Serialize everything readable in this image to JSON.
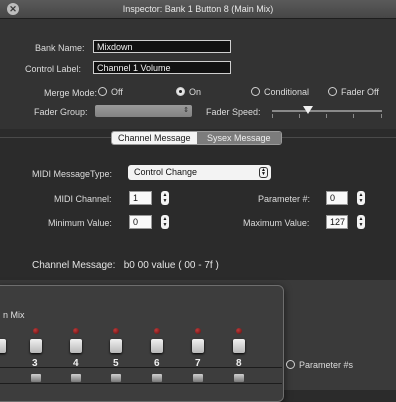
{
  "window": {
    "title": "Inspector: Bank 1 Button 8 (Main Mix)"
  },
  "general": {
    "bank_name_label": "Bank Name:",
    "bank_name_value": "Mixdown",
    "control_label_label": "Control Label:",
    "control_label_value": "Channel 1 Volume",
    "merge_mode_label": "Merge Mode:",
    "merge_options": [
      "Off",
      "On",
      "Conditional",
      "Fader Off"
    ],
    "merge_selected": "On",
    "fader_group_label": "Fader Group:",
    "fader_speed_label": "Fader Speed:",
    "fader_speed_level": 0.33
  },
  "tabs": [
    {
      "label": "Channel Message",
      "active": true
    },
    {
      "label": "Sysex Message",
      "active": false
    }
  ],
  "channel": {
    "msg_type_label": "MIDI MessageType:",
    "msg_type_value": "Control Change",
    "midi_channel_label": "MIDI Channel:",
    "midi_channel_value": "1",
    "parameter_label": "Parameter #:",
    "parameter_value": "0",
    "min_label": "Minimum Value:",
    "min_value": "0",
    "max_label": "Maximum Value:",
    "max_value": "127",
    "message_label": "Channel Message:",
    "message_value": "b0 00 value ( 00 - 7f )"
  },
  "overlay_panel": {
    "title": "n Mix",
    "strips": [
      "3",
      "4",
      "5",
      "6",
      "7",
      "8"
    ]
  },
  "parameter_radio_label": "Parameter #s",
  "colors": {
    "background": "#333333",
    "titlebar": "#4f4f4f",
    "led": "#c03a3a"
  }
}
